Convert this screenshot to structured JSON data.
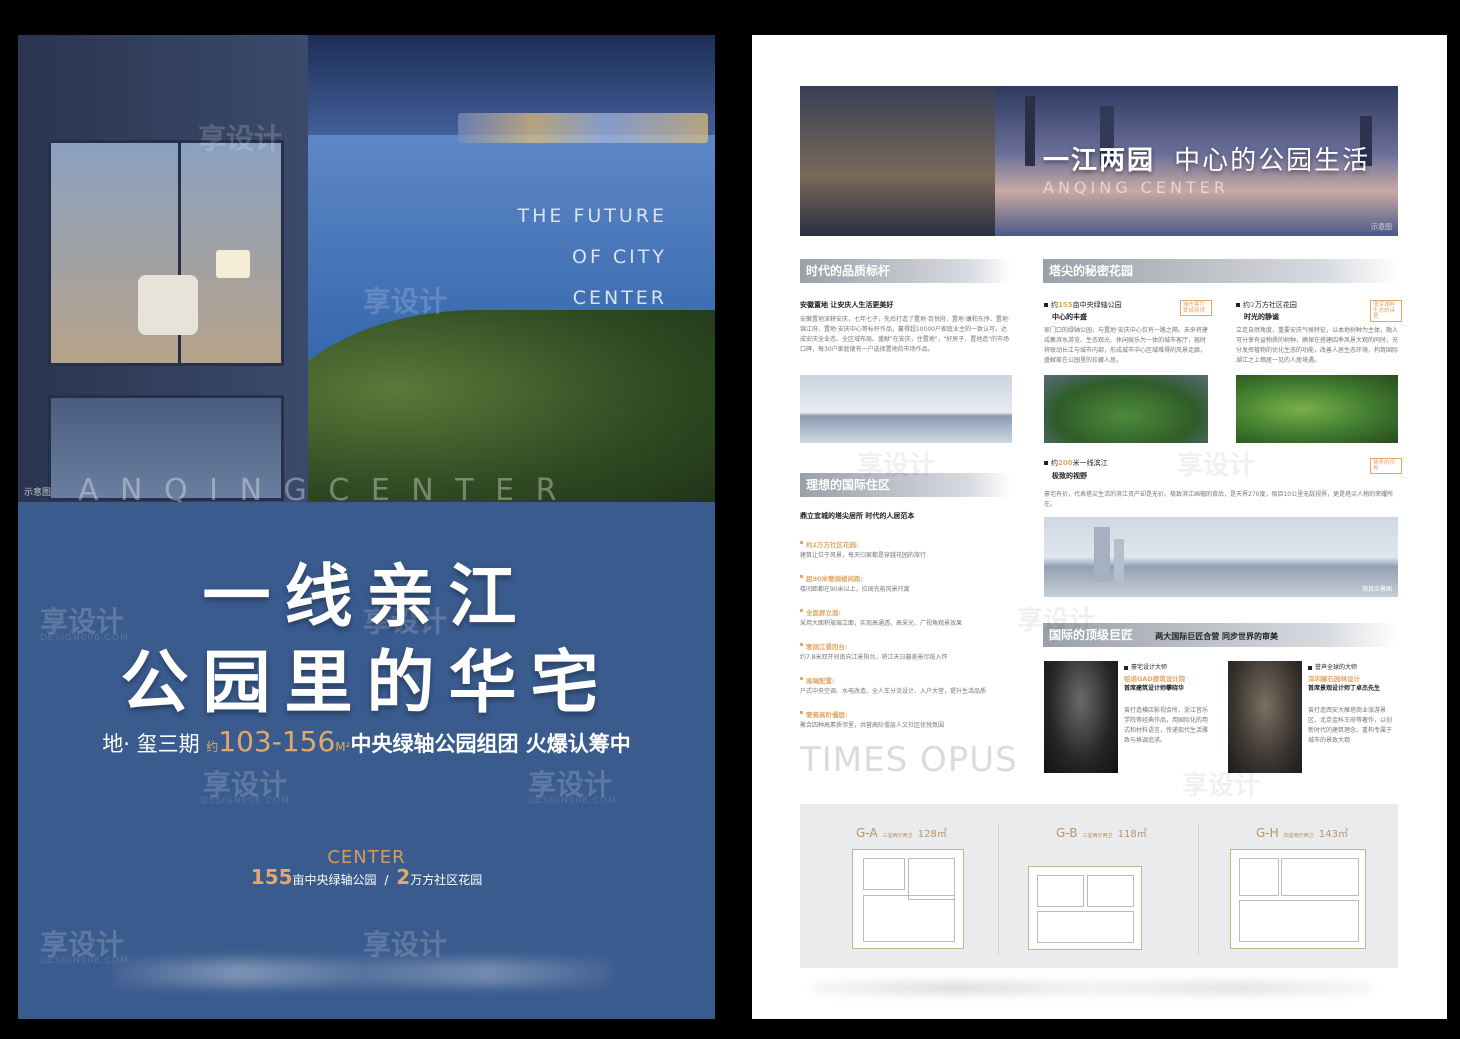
{
  "left": {
    "tagline": [
      "THE FUTURE",
      "OF CITY",
      "CENTER"
    ],
    "watermark": "享设计",
    "watermark_sub": "DESIGN006.COM",
    "hero_caption": "示意图",
    "spaced_letters": "A N Q I N G C E N T E R",
    "title_line1": "一线亲江",
    "title_line2": "公园里的华宅",
    "sub_prefix": "地· 玺三期",
    "sub_small": "约",
    "sub_range": "103-156",
    "sub_unit": "M²",
    "sub_suffix": "中央绿轴公园组团 火爆认筹中",
    "center_logo": "CENTER",
    "stat1_num": "155",
    "stat1_text": "亩中央绿轴公园",
    "stat_sep": "/",
    "stat2_num": "2",
    "stat2_text": "万方社区花园"
  },
  "right": {
    "banner_title_bold": "一江两园",
    "banner_title_thin": "中心的公园生活",
    "banner_sub": "ANQING CENTER",
    "banner_caption": "示意图",
    "sec1": {
      "title": "时代的品质标杆",
      "lead": "安徽置地 让安庆人生活更美好",
      "body": "安徽置地深耕安庆，七年七子，先后打造了置地·百悦府、置地·康和东序、置地·锦江府、置地·安庆中心等标杆作品，赢得超10000户家庭业主的一致认可。达成安庆全业态、全区域布局。盛献\"在安庆，住置地\"，\"好房子，置地造\"的市场口碑，每30户家庭便有一户选择置地的市场作品。"
    },
    "sec2": {
      "title": "塔尖的秘密花园",
      "item1_pre": "约",
      "item1_num": "155",
      "item1_text": "亩中央绿轴公园",
      "item1_sub": "中心的丰盛",
      "item1_body": "家门口的绿轴公园，与置地·安庆中心仅有一路之隔。未来将建成集滨水游览、生态观光、休闲娱乐为一体的城市客厅，届时将联动长江与城市内部，形成城市中心区域难得的风景走廊，盛献家在公园里的珍藏人居。",
      "item1_tag": "城市客厅 繁城秘境",
      "item2_pre": "约",
      "item2_num": "2",
      "item2_text": "万方社区花园",
      "item2_sub": "时光的静谧",
      "item2_body": "立足自然角度，重要安庆气候特征，以本地树种为主体，融入可分享有益物质的树种，确保在搭建四季风景大观的同时，充分发挥植物的优化生态的功能，改善人居生态环境，构筑国际湖江之上栖居一见的人居境遇。",
      "item2_tag": "漫享湖畔 生态的诗意",
      "item3_pre": "约",
      "item3_num": "200",
      "item3_text": "米一线滨江",
      "item3_sub": "极致的视野",
      "item3_body": "豪宅有价，代表塔尖生活的滨江资产却是无价。极致滨江画幅的背后，是天界270度，极目10公里无敌视界，更是塔尖人物的荣耀所在。",
      "item3_tag": "稀贵的视界",
      "img_caption": "项目实景图"
    },
    "sec3": {
      "title": "理想的国际住区",
      "lead": "鼎立宜城的塔尖居所 时代的人居范本",
      "items": [
        {
          "label": "约2万方社区花园:",
          "text": "建筑让位于风景，每天归家都是穿越花园的旅行"
        },
        {
          "label": "超90米奢阔楼间距:",
          "text": "楼间距都在90米以上，拉阔充裕风景尺度"
        },
        {
          "label": "全面屏立面:",
          "text": "采用大面积玻璃立面，实现高通透、高采光、广视角观景效果"
        },
        {
          "label": "奢阔江景阳台:",
          "text": "约7.8米双开间南向江景阳台，将江天日暮美景尽揽入怀"
        },
        {
          "label": "高端配置:",
          "text": "户式中央空调、水电改造、全人车分流设计、入户大堂，提升生活品质"
        },
        {
          "label": "奢美高阶僵层:",
          "text": "聚合四种高素质邻里，共营高阶僵层人文社区优悦氛围"
        }
      ]
    },
    "sec4": {
      "title": "国际的顶级巨匠",
      "subtitle": "两大国际巨匠合营 同步世界的审美",
      "p1_role": "豪宅设计大师",
      "p1_company": "铂诺GAD建筑设计院",
      "p1_name": "首席建筑设计师攀晓华",
      "p1_body": "曾打造横店影视会所、浙江音乐学院等经典作品，用国际化的用式和材料语言，传递现代生活雅致与格调追求。",
      "p2_role": "誉声全球的大师",
      "p2_company": "深圳郦石园林设计",
      "p2_name": "首席景观设计师丁卓杰先生",
      "p2_body": "曾打造西安大雁塔商业旅游景区、北京金科王府等著作，以创新时代的建筑理念，重构专属于城市的景致大观"
    },
    "times_opus": "TIMES OPUS",
    "plans": [
      {
        "code": "G-A",
        "desc": "三室两厅两卫",
        "area": "128㎡"
      },
      {
        "code": "G-B",
        "desc": "三室两厅两卫",
        "area": "118㎡"
      },
      {
        "code": "G-H",
        "desc": "四室两厅两卫",
        "area": "143㎡"
      }
    ],
    "watermark": "享设计"
  }
}
